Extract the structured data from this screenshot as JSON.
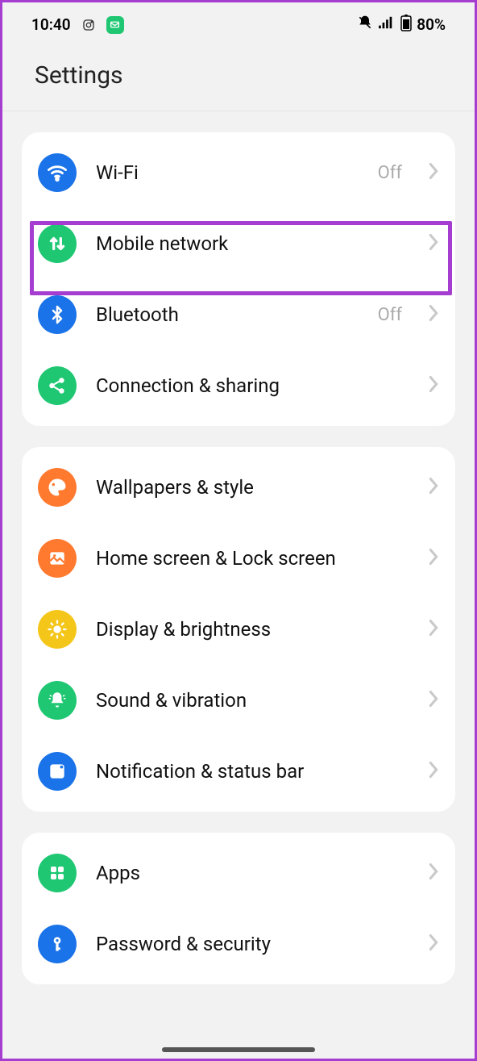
{
  "status": {
    "time": "10:40",
    "battery": "80%"
  },
  "page": {
    "title": "Settings"
  },
  "groups": [
    {
      "items": [
        {
          "label": "Wi-Fi",
          "status": "Off"
        },
        {
          "label": "Mobile network",
          "status": ""
        },
        {
          "label": "Bluetooth",
          "status": "Off"
        },
        {
          "label": "Connection & sharing",
          "status": ""
        }
      ]
    },
    {
      "items": [
        {
          "label": "Wallpapers & style",
          "status": ""
        },
        {
          "label": "Home screen & Lock screen",
          "status": ""
        },
        {
          "label": "Display & brightness",
          "status": ""
        },
        {
          "label": "Sound & vibration",
          "status": ""
        },
        {
          "label": "Notification & status bar",
          "status": ""
        }
      ]
    },
    {
      "items": [
        {
          "label": "Apps",
          "status": ""
        },
        {
          "label": "Password & security",
          "status": ""
        }
      ]
    }
  ]
}
